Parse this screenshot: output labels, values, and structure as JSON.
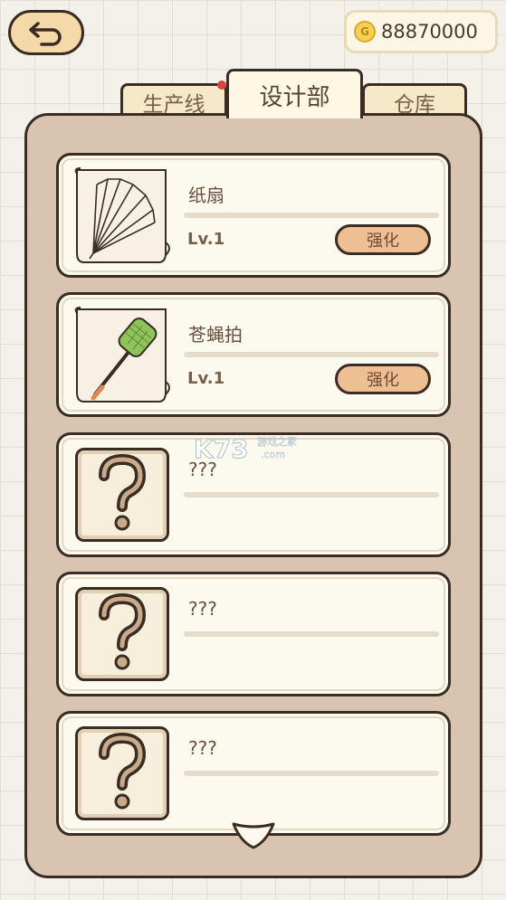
{
  "header": {
    "back_icon": "back-arrow-icon",
    "coins": "88870000",
    "coin_letter": "G"
  },
  "tabs": [
    {
      "label": "生产线",
      "active": false,
      "badge": true
    },
    {
      "label": "设计部",
      "active": true,
      "badge": false
    },
    {
      "label": "仓库",
      "active": false,
      "badge": false
    }
  ],
  "items": [
    {
      "name": "纸扇",
      "level": "Lv.1",
      "upgrade": "强化",
      "icon": "paper-fan-icon"
    },
    {
      "name": "苍蝇拍",
      "level": "Lv.1",
      "upgrade": "强化",
      "icon": "fly-swatter-icon"
    },
    {
      "name": "???",
      "icon": "question-mark-icon"
    },
    {
      "name": "???",
      "icon": "question-mark-icon"
    },
    {
      "name": "???",
      "icon": "question-mark-icon"
    }
  ],
  "watermark": "k73 游戏之家 .com",
  "colors": {
    "accent": "#efbf94",
    "panel": "#d9c3b1",
    "card": "#fcfaee",
    "badge": "#d8433a"
  }
}
